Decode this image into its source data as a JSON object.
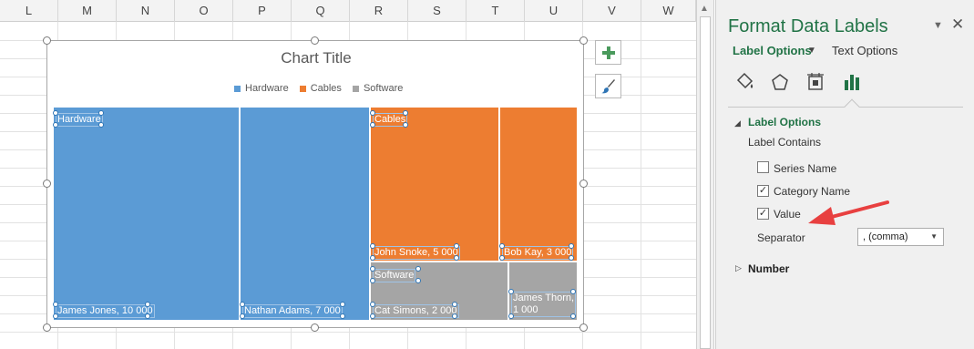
{
  "columns": [
    "L",
    "M",
    "N",
    "O",
    "P",
    "Q",
    "R",
    "S",
    "T",
    "U",
    "V",
    "W"
  ],
  "chart": {
    "title": "Chart Title",
    "legend": [
      {
        "name": "Hardware",
        "color": "#5b9bd5"
      },
      {
        "name": "Cables",
        "color": "#ed7d31"
      },
      {
        "name": "Software",
        "color": "#a5a5a5"
      }
    ],
    "group_labels": {
      "hardware": "Hardware",
      "cables": "Cables",
      "software": "Software"
    },
    "tiles": [
      {
        "label": "James Jones, 10 000"
      },
      {
        "label": "Nathan Adams, 7 000"
      },
      {
        "label": "John Snoke, 5 000"
      },
      {
        "label": "Bob Kay, 3 000"
      },
      {
        "label": "Cat Simons, 2 000"
      },
      {
        "label_line1": "James Thorn,",
        "label_line2": "1 000"
      }
    ]
  },
  "chart_data": {
    "type": "treemap",
    "title": "Chart Title",
    "categories": [
      "Hardware",
      "Cables",
      "Software"
    ],
    "series": [
      {
        "name": "Hardware",
        "points": [
          {
            "name": "James Jones",
            "value": 10000
          },
          {
            "name": "Nathan Adams",
            "value": 7000
          }
        ]
      },
      {
        "name": "Cables",
        "points": [
          {
            "name": "John Snoke",
            "value": 5000
          },
          {
            "name": "Bob Kay",
            "value": 3000
          }
        ]
      },
      {
        "name": "Software",
        "points": [
          {
            "name": "Cat Simons",
            "value": 2000
          },
          {
            "name": "James Thorn",
            "value": 1000
          }
        ]
      }
    ]
  },
  "pane": {
    "title": "Format Data Labels",
    "tabs": {
      "label_options": "Label Options",
      "text_options": "Text Options"
    },
    "section_label_options": "Label Options",
    "label_contains": "Label Contains",
    "checkboxes": [
      {
        "label": "Series Name",
        "checked": false
      },
      {
        "label": "Category Name",
        "checked": true
      },
      {
        "label": "Value",
        "checked": true
      }
    ],
    "separator_label": "Separator",
    "separator_value": ", (comma)",
    "section_number": "Number"
  }
}
